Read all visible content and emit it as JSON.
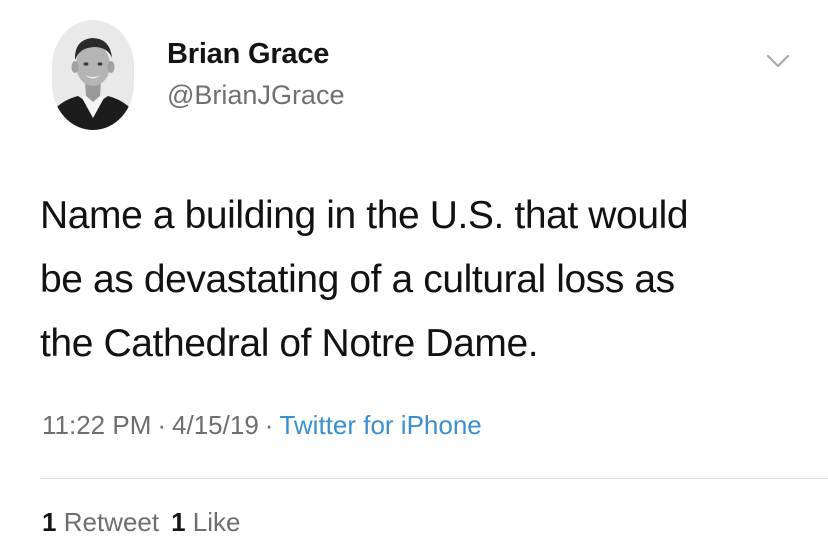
{
  "user": {
    "display_name": "Brian Grace",
    "handle": "@BrianJGrace",
    "avatar_icon": "profile-photo"
  },
  "menu": {
    "icon": "chevron-down-icon"
  },
  "tweet": {
    "text_lines": [
      "Name a building in the U.S. that would",
      "be as devastating of a cultural loss as",
      "the Cathedral of Notre Dame."
    ]
  },
  "meta": {
    "time": "11:22 PM",
    "date": "4/15/19",
    "separator": "·",
    "source": "Twitter for iPhone"
  },
  "stats": {
    "retweets_count": "1",
    "retweets_label": "Retweet",
    "likes_count": "1",
    "likes_label": "Like"
  },
  "colors": {
    "background": "#ffffff",
    "text": "#121212",
    "secondary_text": "#6e6e6e",
    "link": "#3a8fd0",
    "divider": "#dcdcdc"
  }
}
